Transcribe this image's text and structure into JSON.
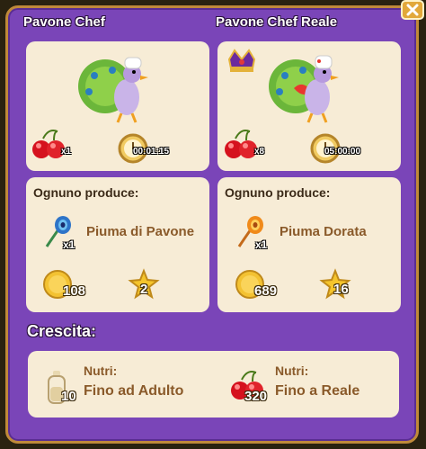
{
  "left": {
    "title": "Pavone Chef",
    "cost_count": "x1",
    "timer": "00:01:15",
    "produce_label": "Ognuno produce:",
    "item_name": "Piuma di Pavone",
    "item_count": "x1",
    "coins": "108",
    "xp": "2"
  },
  "right": {
    "title": "Pavone Chef Reale",
    "cost_count": "x8",
    "timer": "05:00:00",
    "produce_label": "Ognuno produce:",
    "item_name": "Piuma Dorata",
    "item_count": "x1",
    "coins": "689",
    "xp": "16"
  },
  "growth": {
    "title": "Crescita:",
    "feed1": {
      "label": "Nutri:",
      "value": "Fino ad Adulto",
      "count": "10"
    },
    "feed2": {
      "label": "Nutri:",
      "value": "Fino a Reale",
      "count": "320"
    }
  },
  "icons": {
    "close": "close-icon",
    "cherries": "cherries-icon",
    "clock": "clock-icon",
    "feather_blue": "peacock-feather-icon",
    "feather_gold": "golden-feather-icon",
    "coin": "coin-icon",
    "star": "star-icon",
    "crown": "crown-icon",
    "bottle": "milk-bottle-icon"
  }
}
